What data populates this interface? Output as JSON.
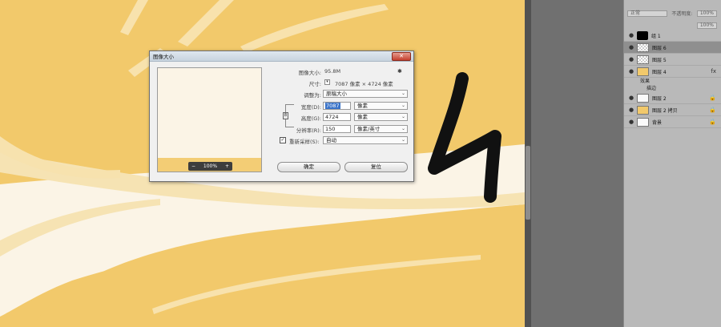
{
  "dialog": {
    "title": "图像大小",
    "close_glyph": "✕",
    "image_size_label": "图像大小:",
    "image_size_value": "95.8M",
    "dimensions_label": "尺寸:",
    "dimensions_value": "7087 像素  ×  4724 像素",
    "fit_to_label": "调整为:",
    "fit_to_value": "原稿大小",
    "width_label": "宽度(D):",
    "width_value": "7087",
    "width_unit": "像素",
    "height_label": "高度(G):",
    "height_value": "4724",
    "height_unit": "像素",
    "resolution_label": "分辨率(R):",
    "resolution_value": "150",
    "resolution_unit": "像素/英寸",
    "resample_label": "重新采样(S):",
    "resample_checked_glyph": "✓",
    "resample_value": "自动",
    "preview_zoom": "100%",
    "zoom_minus": "−",
    "zoom_plus": "+",
    "ok_label": "确定",
    "reset_label": "复位",
    "gear_glyph": "✱",
    "link_glyph": "8"
  },
  "layers_panel": {
    "blend_mode": "正常",
    "opacity_label": "不透明度:",
    "opacity_value": "100%",
    "fill_value": "100%",
    "eye_glyph": "●",
    "lock_glyph": "🔒",
    "fx_glyph": "fx",
    "items": [
      {
        "name": "组 1"
      },
      {
        "name": "图层 6"
      },
      {
        "name": "图层 5"
      },
      {
        "name": "图层 4"
      },
      {
        "name": "图层 2"
      },
      {
        "name": "图层 2 拷贝"
      },
      {
        "name": "背景"
      }
    ],
    "effects_label": "效果",
    "stroke_label": "描边"
  },
  "colors": {
    "canvas_orange": "#f2c96b",
    "canvas_cream": "#fbf4e6",
    "panel_gray": "#b9b9b9",
    "selected_row": "#8f8f8f"
  }
}
